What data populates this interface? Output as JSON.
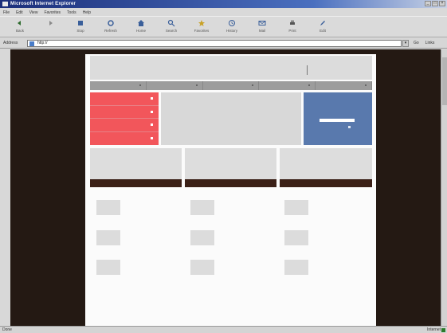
{
  "window": {
    "title": "Microsoft Internet Explorer",
    "buttons": [
      "_",
      "□",
      "×"
    ]
  },
  "menubar": {
    "items": [
      "File",
      "Edit",
      "View",
      "Favorites",
      "Tools",
      "Help"
    ]
  },
  "toolbar": {
    "buttons": [
      {
        "label": "Back",
        "icon": "back-arrow-icon"
      },
      {
        "label": "",
        "icon": "forward-arrow-icon"
      },
      {
        "label": "Stop",
        "icon": "stop-icon"
      },
      {
        "label": "Refresh",
        "icon": "refresh-icon"
      },
      {
        "label": "Home",
        "icon": "home-icon"
      },
      {
        "label": "Search",
        "icon": "search-icon"
      },
      {
        "label": "Favorites",
        "icon": "favorites-icon"
      },
      {
        "label": "History",
        "icon": "history-icon"
      },
      {
        "label": "Mail",
        "icon": "mail-icon"
      },
      {
        "label": "Print",
        "icon": "print-icon"
      },
      {
        "label": "Edit",
        "icon": "edit-icon"
      }
    ]
  },
  "address": {
    "label": "Address",
    "url": "http://",
    "go": "Go",
    "links": "Links"
  },
  "status": {
    "text": "Done",
    "zone": "Internet"
  },
  "colors": {
    "red_menu": "#f2565b",
    "blue_panel": "#5979ad",
    "dark_bar": "#3b2017",
    "viewport_bg": "#241913"
  }
}
